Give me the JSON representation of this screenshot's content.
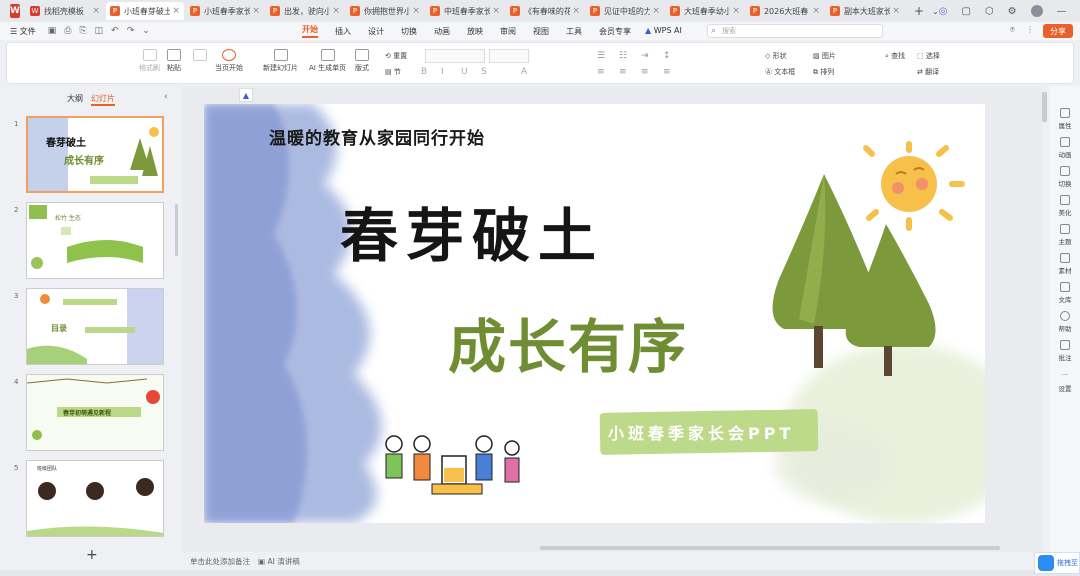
{
  "tabs": [
    {
      "label": "找稻壳模板",
      "kind": "w",
      "active": false
    },
    {
      "label": "小班春芽破土",
      "kind": "p",
      "active": true
    },
    {
      "label": "小班春季家长",
      "kind": "p",
      "active": false
    },
    {
      "label": "出发，驶向小班",
      "kind": "p",
      "active": false
    },
    {
      "label": "你拥抱世界小",
      "kind": "p",
      "active": false
    },
    {
      "label": "中班春季家长",
      "kind": "p",
      "active": false
    },
    {
      "label": "《有春味的花》",
      "kind": "p",
      "active": false
    },
    {
      "label": "见证中班的力量",
      "kind": "p",
      "active": false
    },
    {
      "label": "大班春季幼小",
      "kind": "p",
      "active": false
    },
    {
      "label": "2026大班春",
      "kind": "p",
      "active": false
    },
    {
      "label": "副本大班家长会",
      "kind": "p",
      "active": false
    }
  ],
  "menu": {
    "file": "☰ 文件",
    "items": [
      "开始",
      "插入",
      "设计",
      "切换",
      "动画",
      "放映",
      "审阅",
      "视图",
      "工具",
      "会员专享"
    ],
    "active": "开始",
    "wps_ai": "WPS AI",
    "search_placeholder": "搜索",
    "share": "分享"
  },
  "ribbon": {
    "format_painter": "格式刷",
    "paste": "粘贴",
    "slideshow_start": "当页开始",
    "new_slide": "新建幻灯片",
    "ai_generate": "AI 生成单页",
    "layout": "版式",
    "reset": "重置",
    "section": "节",
    "shape": "形状",
    "picture": "图片",
    "textbox": "文本框",
    "arrange": "排列",
    "find": "查找",
    "select": "选择",
    "translate": "翻译",
    "font_format": [
      "B",
      "I",
      "U",
      "S",
      "A"
    ]
  },
  "left_panel": {
    "tab_outline": "大纲",
    "tab_slides": "幻灯片",
    "collapse": "‹",
    "add": "+",
    "thumbnails": [
      {
        "num": "1",
        "title": "春芽破土",
        "subtitle": "成长有序"
      },
      {
        "num": "2",
        "title": "松竹 生态",
        "subtitle": ""
      },
      {
        "num": "3",
        "title": "目录",
        "subtitle": ""
      },
      {
        "num": "4",
        "title": "春芽初萌遇见新程",
        "subtitle": ""
      },
      {
        "num": "5",
        "title": "班级团队",
        "subtitle": ""
      }
    ]
  },
  "slide": {
    "subtitle": "温暖的教育从家园同行开始",
    "title1": "春芽破土",
    "title2": "成长有序",
    "banner": "小班春季家长会PPT"
  },
  "right_rail": [
    "属性",
    "动画",
    "切换",
    "美化",
    "主题",
    "素材",
    "文库",
    "帮助",
    "批注",
    "设置"
  ],
  "notes": {
    "placeholder": "单击此处添加备注",
    "ai_notes": "AI 演讲稿"
  },
  "badge": "拖拽至",
  "colors": {
    "accent": "#e8602b",
    "title_green": "#6f8d33",
    "banner_green": "#bdd98a",
    "watercolor_blue": "#8fa3d8"
  }
}
